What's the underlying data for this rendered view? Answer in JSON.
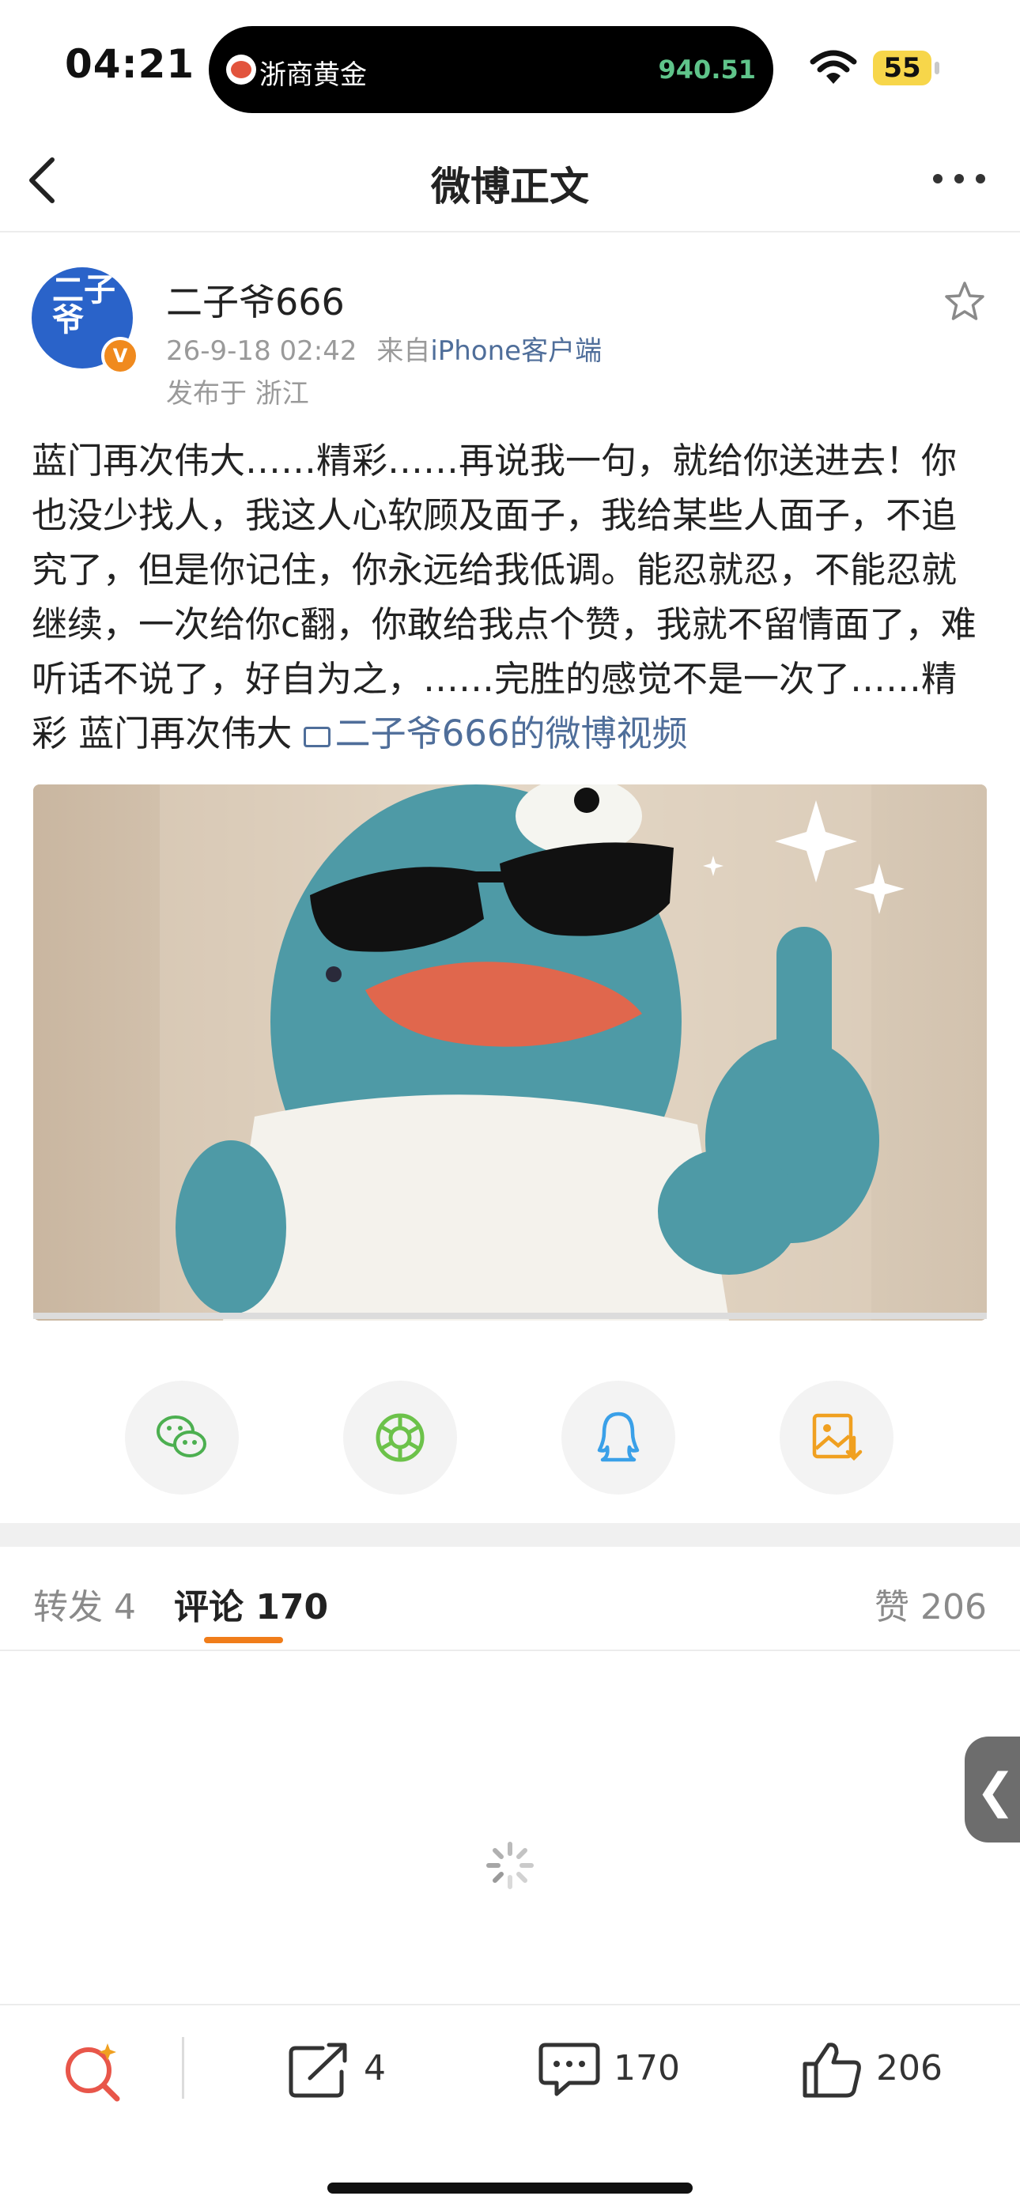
{
  "status_bar": {
    "time": "04:21",
    "island_label": "浙商黄金",
    "island_value": "940.51",
    "battery": "55"
  },
  "nav": {
    "title": "微博正文"
  },
  "author": {
    "name": "二子爷666",
    "avatar_text": "二子爷",
    "time": "26-9-18 02:42",
    "source_prefix": "来自",
    "source": "iPhone客户端",
    "location": "发布于 浙江"
  },
  "post": {
    "text": "蓝门再次伟大……精彩……再说我一句，就给你送进去！你也没少找人，我这人心软顾及面子，我给某些人面子，不追究了，但是你记住，你永远给我低调。能忍就忍，不能忍就继续，一次给你c翻，你敢给我点个赞，我就不留情面了，难听话不说了，好自为之，……完胜的感觉不是一次了……精彩 蓝门再次伟大 ",
    "video_link": "二子爷666的微博视频"
  },
  "share": {
    "icons": [
      "wechat-icon",
      "moments-icon",
      "qq-icon",
      "save-image-icon"
    ]
  },
  "tabs": {
    "repost": "转发 4",
    "comments": "评论 170",
    "likes": "赞 206"
  },
  "bottom_bar": {
    "repost_count": "4",
    "comment_count": "170",
    "like_count": "206"
  },
  "colors": {
    "accent": "#f07d1a",
    "link": "#4f6e9a",
    "wechat": "#4caf50",
    "moments": "#6cc24a",
    "qq": "#3aa0e8",
    "save": "#f0a020"
  }
}
